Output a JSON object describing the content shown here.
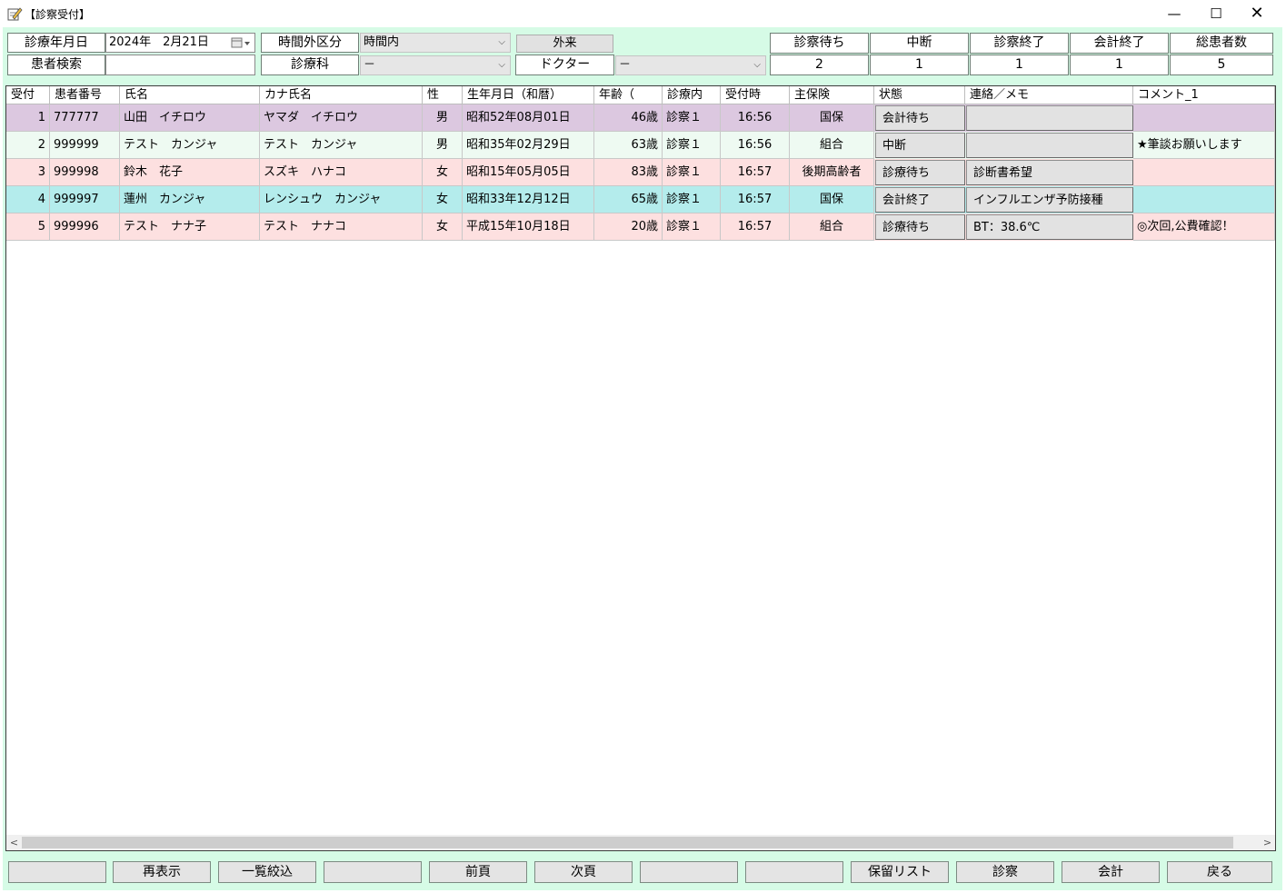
{
  "window": {
    "title": "【診察受付】",
    "minimize": "—",
    "maximize": "☐",
    "close": "✕"
  },
  "filters": {
    "date_label": "診療年月日",
    "date_value": "2024年　2月21日",
    "time_label": "時間外区分",
    "time_value": "時間内",
    "outpatient_label": "外来",
    "search_label": "患者検索",
    "search_value": "",
    "dept_label": "診療科",
    "dept_value": "－",
    "doctor_label": "ドクター",
    "doctor_value": "－"
  },
  "counters": [
    {
      "label": "診察待ち",
      "value": "2"
    },
    {
      "label": "中断",
      "value": "1"
    },
    {
      "label": "診察終了",
      "value": "1"
    },
    {
      "label": "会計終了",
      "value": "1"
    },
    {
      "label": "総患者数",
      "value": "5"
    }
  ],
  "table": {
    "headers": [
      "受付",
      "患者番号",
      "氏名",
      "カナ氏名",
      "性",
      "生年月日（和暦）",
      "年齢（",
      "診療内",
      "受付時",
      "主保険",
      "状態",
      "連絡／メモ",
      "コメント_1"
    ],
    "rows": [
      {
        "no": "1",
        "id": "777777",
        "name": "山田　イチロウ",
        "kana": "ヤマダ　イチロウ",
        "sex": "男",
        "birth": "昭和52年08月01日",
        "age": "46歳",
        "dept": "診察１",
        "time": "16:56",
        "ins": "国保",
        "status": "会計待ち",
        "memo": "",
        "comment": "",
        "color": "#dcc8e0"
      },
      {
        "no": "2",
        "id": "999999",
        "name": "テスト　カンジャ",
        "kana": "テスト　カンジャ",
        "sex": "男",
        "birth": "昭和35年02月29日",
        "age": "63歳",
        "dept": "診察１",
        "time": "16:56",
        "ins": "組合",
        "status": "中断",
        "memo": "",
        "comment": "★筆談お願いします",
        "color": "#eefaf2"
      },
      {
        "no": "3",
        "id": "999998",
        "name": "鈴木　花子",
        "kana": "スズキ　ハナコ",
        "sex": "女",
        "birth": "昭和15年05月05日",
        "age": "83歳",
        "dept": "診察１",
        "time": "16:57",
        "ins": "後期高齢者",
        "status": "診療待ち",
        "memo": "診断書希望",
        "comment": "",
        "color": "#fde0e0"
      },
      {
        "no": "4",
        "id": "999997",
        "name": "蓮州　カンジャ",
        "kana": "レンシュウ　カンジャ",
        "sex": "女",
        "birth": "昭和33年12月12日",
        "age": "65歳",
        "dept": "診察１",
        "time": "16:57",
        "ins": "国保",
        "status": "会計終了",
        "memo": "インフルエンザ予防接種",
        "comment": "",
        "color": "#b4ecec"
      },
      {
        "no": "5",
        "id": "999996",
        "name": "テスト　ナナ子",
        "kana": "テスト　ナナコ",
        "sex": "女",
        "birth": "平成15年10月18日",
        "age": "20歳",
        "dept": "診察１",
        "time": "16:57",
        "ins": "組合",
        "status": "診療待ち",
        "memo": "BT：38.6℃",
        "comment": "◎次回,公費確認！",
        "color": "#fde0e0"
      }
    ]
  },
  "footer": [
    "",
    "再表示",
    "一覧絞込",
    "",
    "前頁",
    "次頁",
    "",
    "",
    "保留リスト",
    "診察",
    "会計",
    "戻る"
  ]
}
